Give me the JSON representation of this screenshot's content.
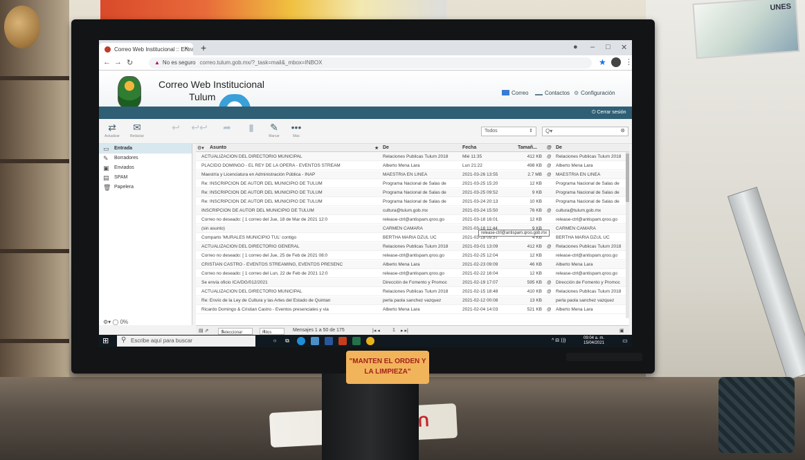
{
  "browser": {
    "tab_title": "Correo Web Institucional :: Entra",
    "new_tab": "+",
    "address": {
      "security": "No es seguro",
      "url": "correo.tulum.gob.mx/?_task=mail&_mbox=INBOX"
    }
  },
  "header": {
    "title": "Correo Web Institucional",
    "subtitle": "Tulum",
    "nav": {
      "mail": "Correo",
      "contacts": "Contactos",
      "settings": "Configuración"
    },
    "user_email": "",
    "logout": "Cerrar sesión"
  },
  "toolbar": {
    "refresh": "Actualizar",
    "compose": "Redactar",
    "mark": "Marcar",
    "more": "Más",
    "filter": "Todos",
    "search_placeholder": "Q▾"
  },
  "folders": [
    {
      "label": "Entrada",
      "icon": "inbox-icon",
      "glyph": "▭",
      "selected": true
    },
    {
      "label": "Borradores",
      "icon": "pencil-icon",
      "glyph": "✎",
      "selected": false
    },
    {
      "label": "Enviados",
      "icon": "sent-icon",
      "glyph": "▣",
      "selected": false
    },
    {
      "label": "SPAM",
      "icon": "spam-icon",
      "glyph": "▤",
      "selected": false
    },
    {
      "label": "Papelera",
      "icon": "trash-icon",
      "glyph": "🗑",
      "selected": false
    }
  ],
  "list": {
    "columns": {
      "subject": "Asunto",
      "from": "De",
      "date": "Fecha",
      "size": "Tamañ...",
      "to": "De"
    },
    "rows": [
      {
        "subject": "ACTUALIZACIÓN DEL DIRECTORIO MUNICIPAL",
        "from": "Relaciones Publicas Tulum 2018",
        "date": "Mié 11:35",
        "size": "412 KB",
        "att": "@",
        "to": "Relaciones Publicas Tulum 2018"
      },
      {
        "subject": "PLÁCIDO DOMINGO - EL REY DE LA ÓPERA - EVENTOS STREAM",
        "from": "Alberto Mena Lara",
        "date": "Lun 21:22",
        "size": "498 KB",
        "att": "@",
        "to": "Alberto Mena Lara"
      },
      {
        "subject": "Maestría y Licenciatura en Administración Pública - INAP",
        "from": "MAESTRIA EN LINEA",
        "date": "2021-03-26 13:55",
        "size": "2.7 MB",
        "att": "@",
        "to": "MAESTRIA EN LINEA"
      },
      {
        "subject": "Re: INSCRIPCION DE AUTOR DEL MUNICIPIO DE TULUM",
        "from": "Programa Nacional de Salas de",
        "date": "2021-03-25 15:20",
        "size": "12 KB",
        "att": "",
        "to": "Programa Nacional de Salas de"
      },
      {
        "subject": "Re: INSCRIPCION DE AUTOR DEL MUNICIPIO DE TULUM",
        "from": "Programa Nacional de Salas de",
        "date": "2021-03-25 09:52",
        "size": "9 KB",
        "att": "",
        "to": "Programa Nacional de Salas de"
      },
      {
        "subject": "Re: INSCRIPCION DE AUTOR DEL MUNICIPIO DE TULUM",
        "from": "Programa Nacional de Salas de",
        "date": "2021-03-24 20:13",
        "size": "10 KB",
        "att": "",
        "to": "Programa Nacional de Salas de"
      },
      {
        "subject": "INSCRIPCION DE AUTOR DEL MUNICIPIO DE TULUM",
        "from": "cultura@tulum.gob.mx",
        "date": "2021-03-24 15:50",
        "size": "76 KB",
        "att": "@",
        "to": "cultura@tulum.gob.mx"
      },
      {
        "subject": "Correo no deseado: [ 1 correo del Jue, 18 de Mar de 2021 12:0",
        "from": "release-ctrl@antispam.qroo.go",
        "date": "2021-03-18 16:01",
        "size": "12 KB",
        "att": "",
        "to": "release-ctrl@antispam.qroo.go"
      },
      {
        "subject": "(sin asunto)",
        "from": "CARMEN CAMARA",
        "date": "2021-03-18 11:44",
        "size": "9 KB",
        "att": "",
        "to": "CARMEN CAMARA"
      },
      {
        "subject": "Comparto 'MURALES MUNICIPIO TUL' contigo",
        "from": "BERTHA MARIA DZUL UC",
        "date": "2021-03-18 09:57",
        "size": "4 KB",
        "att": "",
        "to": "BERTHA MARIA DZUL UC"
      },
      {
        "subject": "ACTUALIZACIÓN DEL DIRECTORIO GENERAL",
        "from": "Relaciones Publicas Tulum 2018",
        "date": "2021-03-01 13:09",
        "size": "412 KB",
        "att": "@",
        "to": "Relaciones Publicas Tulum 2018"
      },
      {
        "subject": "Correo no deseado: [ 1 correo del Jue, 25 de Feb de 2021 08:0",
        "from": "release-ctrl@antispam.qroo.go",
        "date": "2021-02-25 12:04",
        "size": "12 KB",
        "att": "",
        "to": "release-ctrl@antispam.qroo.go"
      },
      {
        "subject": "CRISTIAN CASTRO - EVENTOS STREAMING, EVENTOS PRESENC",
        "from": "Alberto Mena Lara",
        "date": "2021-02-23 09:09",
        "size": "46 KB",
        "att": "",
        "to": "Alberto Mena Lara"
      },
      {
        "subject": "Correo no deseado: [ 1 correo del Lun, 22 de Feb de 2021 12:0",
        "from": "release-ctrl@antispam.qroo.go",
        "date": "2021-02-22 16:04",
        "size": "12 KB",
        "att": "",
        "to": "release-ctrl@antispam.qroo.go"
      },
      {
        "subject": "Se envía oficio ICA/DG/012/2021",
        "from": "Dirección de Fomento y Promoc",
        "date": "2021-02-19 17:07",
        "size": "595 KB",
        "att": "@",
        "to": "Dirección de Fomento y Promoc"
      },
      {
        "subject": "ACTUALIZACIÓN DEL DIRECTORIO MUNICIPAL",
        "from": "Relaciones Publicas Tulum 2018",
        "date": "2021-02-15 18:48",
        "size": "410 KB",
        "att": "@",
        "to": "Relaciones Publicas Tulum 2018"
      },
      {
        "subject": "Re: Envío de la Ley de Cultura y las Artes del Estado de Quintan",
        "from": "perla paola sanchez vazquez",
        "date": "2021-02-12 00:08",
        "size": "13 KB",
        "att": "",
        "to": "perla paola sanchez vazquez"
      },
      {
        "subject": "Ricardo Domingo & Cristian Castro - Eventos presenciales y via",
        "from": "Alberto Mena Lara",
        "date": "2021-02-04 14:03",
        "size": "521 KB",
        "att": "@",
        "to": "Alberto Mena Lara"
      }
    ],
    "tooltip": "release-ctrl@antispam.qroo.gob.mx",
    "footer": {
      "select": "Seleccionar",
      "threads": "Hilos",
      "count": "Mensajes 1 a 50 de 175",
      "page": "1"
    }
  },
  "sidebar_footer": {
    "quota": "0%"
  },
  "taskbar": {
    "search_placeholder": "Escribe aquí para buscar",
    "time": "09:04 a. m.",
    "date": "15/04/2021"
  },
  "room": {
    "monitor_label": "\"MANTEN EL ORDEN Y LA LIMPIEZA\"",
    "poster_text": "UNES",
    "sticker_text": "UTP"
  },
  "colors": {
    "accent": "#3b7f9f",
    "dark_bar": "#2f5f75",
    "selected_folder": "#d9e8ef"
  }
}
